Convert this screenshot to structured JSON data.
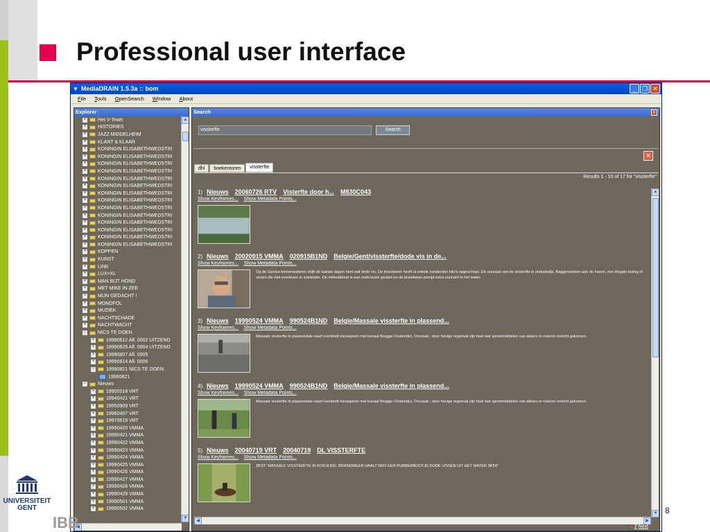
{
  "slide": {
    "title": "Professional user interface",
    "page_number": "8",
    "logo_text_1": "UNIVERSITEIT",
    "logo_text_2": "GENT",
    "partner_text": "IBB",
    "accent_color": "#e2004e"
  },
  "window": {
    "title": "MediaDRAIN 1.5.3a :: bom",
    "menu": [
      "File",
      "Tools",
      "OpenSearch",
      "Window",
      "About"
    ]
  },
  "explorer": {
    "title": "Explorer",
    "items": [
      {
        "label": "Het V-Team",
        "level": 0,
        "type": "folder"
      },
      {
        "label": "HISTORIES",
        "level": 0,
        "type": "folder"
      },
      {
        "label": "JAZZ MIDDELHEIM",
        "level": 0,
        "type": "folder"
      },
      {
        "label": "KLANT & KLAAR",
        "level": 0,
        "type": "folder"
      },
      {
        "label": "KONINGIN ELISABETHWEDSTRI",
        "level": 0,
        "type": "folder"
      },
      {
        "label": "KONINGIN ELISABETHWEDSTRI",
        "level": 0,
        "type": "folder"
      },
      {
        "label": "KONINGIN ELISABETHWEDSTRI",
        "level": 0,
        "type": "folder"
      },
      {
        "label": "KONINGIN ELISABETHWEDSTRI",
        "level": 0,
        "type": "folder"
      },
      {
        "label": "KONINGIN ELISABETHWEDSTRI",
        "level": 0,
        "type": "folder"
      },
      {
        "label": "KONINGIN ELISABETHWEDSTRI",
        "level": 0,
        "type": "folder"
      },
      {
        "label": "KONINGIN ELISABETHWEDSTRI",
        "level": 0,
        "type": "folder"
      },
      {
        "label": "KONINGIN ELISABETHWEDSTRI",
        "level": 0,
        "type": "folder"
      },
      {
        "label": "KONINGIN ELISABETHWEDSTRI",
        "level": 0,
        "type": "folder"
      },
      {
        "label": "KONINGIN ELISABETHWEDSTRI",
        "level": 0,
        "type": "folder"
      },
      {
        "label": "KONINGIN ELISABETHWEDSTRI",
        "level": 0,
        "type": "folder"
      },
      {
        "label": "KONINGIN ELISABETHWEDSTRI",
        "level": 0,
        "type": "folder"
      },
      {
        "label": "KONINGIN ELISABETHWEDSTRI",
        "level": 0,
        "type": "folder"
      },
      {
        "label": "KONINGIN ELISABETHWEDSTRI",
        "level": 0,
        "type": "folder"
      },
      {
        "label": "KOPPEN",
        "level": 0,
        "type": "folder"
      },
      {
        "label": "KUNST",
        "level": 0,
        "type": "folder"
      },
      {
        "label": "LINK",
        "level": 0,
        "type": "folder"
      },
      {
        "label": "LUX>XL",
        "level": 0,
        "type": "folder"
      },
      {
        "label": "MAN BIJT HOND",
        "level": 0,
        "type": "folder"
      },
      {
        "label": "MET MIKE IN ZEE",
        "level": 0,
        "type": "folder"
      },
      {
        "label": "MIJN GEDACHT !",
        "level": 0,
        "type": "folder"
      },
      {
        "label": "MONDFOL",
        "level": 0,
        "type": "folder"
      },
      {
        "label": "MUZIEK",
        "level": 0,
        "type": "folder"
      },
      {
        "label": "NACHTSCHADE",
        "level": 0,
        "type": "folder"
      },
      {
        "label": "NACHTWACHT",
        "level": 0,
        "type": "folder"
      },
      {
        "label": "NICS TE DOEN",
        "level": 0,
        "type": "folder-open"
      },
      {
        "label": "19990612 Afl. 0002 UITZEND",
        "level": 1,
        "type": "folder"
      },
      {
        "label": "19990626 Afl. 0004 UITZEND",
        "level": 1,
        "type": "folder"
      },
      {
        "label": "19990807 Afl. 0005",
        "level": 1,
        "type": "folder"
      },
      {
        "label": "19990814 Afl. 0006",
        "level": 1,
        "type": "folder"
      },
      {
        "label": "19990821 NICS TE DOEN:",
        "level": 1,
        "type": "folder-open"
      },
      {
        "label": "19990821",
        "level": 2,
        "type": "doc"
      },
      {
        "label": "Nieuws",
        "level": 0,
        "type": "folder-open"
      },
      {
        "label": "19900518 VRT",
        "level": 1,
        "type": "folder"
      },
      {
        "label": "19940421 VRT",
        "level": 1,
        "type": "folder"
      },
      {
        "label": "19950909 VRT",
        "level": 1,
        "type": "folder"
      },
      {
        "label": "19960407 VRT",
        "level": 1,
        "type": "folder"
      },
      {
        "label": "19970619 VRT",
        "level": 1,
        "type": "folder"
      },
      {
        "label": "19990420 VMMA",
        "level": 1,
        "type": "folder"
      },
      {
        "label": "19990421 VMMA",
        "level": 1,
        "type": "folder"
      },
      {
        "label": "19990422 VMMA",
        "level": 1,
        "type": "folder"
      },
      {
        "label": "19990423 VMMA",
        "level": 1,
        "type": "folder"
      },
      {
        "label": "19990424 VMMA",
        "level": 1,
        "type": "folder"
      },
      {
        "label": "19990425 VMMA",
        "level": 1,
        "type": "folder"
      },
      {
        "label": "19990426 VMMA",
        "level": 1,
        "type": "folder"
      },
      {
        "label": "19990427 VMMA",
        "level": 1,
        "type": "folder"
      },
      {
        "label": "19990428 VMMA",
        "level": 1,
        "type": "folder"
      },
      {
        "label": "19990429 VMMA",
        "level": 1,
        "type": "folder"
      },
      {
        "label": "19990501 VMMA",
        "level": 1,
        "type": "folder"
      },
      {
        "label": "19990502 VMMA",
        "level": 1,
        "type": "folder"
      }
    ]
  },
  "search": {
    "title": "Search",
    "query": "vissterfte",
    "button_label": "Search",
    "tabs": [
      "dhl",
      "boekentoren",
      "vissterfte"
    ],
    "active_tab": 2,
    "count_text": "Results 1 - 10 of 17 for \"vissterfte\"",
    "show_keyframes": "Show Keyframes...",
    "show_metadata": "Show Metadata Points...",
    "pager_prefix": "1",
    "pager_page": "2",
    "pager_next": "Next",
    "results": [
      {
        "num": "1)",
        "links": [
          "Nieuws",
          "20060726 RTV",
          "Visterfte door h...",
          "M830C043"
        ],
        "text": "",
        "thumb": "river-water"
      },
      {
        "num": "2)",
        "links": [
          "Nieuws",
          "20020915 VMMA",
          "020915B1ND",
          "Belgie/Gent/vissterfte/dode vis in de..."
        ],
        "text": "Op de Gentse binnenwateren drijft de laatste dagen heel wat dode vis. De brandweer heeft al enkele honderden kilo's opgeschept. De oorzaak van de vissterfte is onduidelijk. Baggerwerken aan de haven, een illegale lozing of vissen die niet overleven in zoetwater. De milieudienst is een onderzoek gestart en de brandweer pompt extra zuurstof in het water.",
        "thumb": "man-portrait"
      },
      {
        "num": "3)",
        "links": [
          "Nieuws",
          "19990524 VMMA",
          "990524B1ND",
          "Belgie/Massale vissterfte in plassend..."
        ],
        "text": "Massale vissterfte in plassendale-vaart (verbindt nieuwpoort met kanaal Brugge-Oostende). Oorzaak : door hevige regenval zijn heel wat sproeimiddelen van akkers in rivieren terecht gekomen.",
        "thumb": "water-surface"
      },
      {
        "num": "4)",
        "links": [
          "Nieuws",
          "19990524 VMMA",
          "990524B1ND",
          "Belgie/Massale vissterfte in plassend..."
        ],
        "text": "Massale vissterfte in plassendale-vaart (verbindt nieuwpoort met kanaal Brugge-Oostende). Oorzaak : door hevige regenval zijn heel wat sproeimiddelen van akkers in rivieren terecht gekomen.",
        "thumb": "people-field"
      },
      {
        "num": "5)",
        "links": [
          "Nieuws",
          "20040719 VRT",
          "20040719",
          "DL VISSTERFTE"
        ],
        "text": "38'23'' MASSALE VISSTERFTE IN KOKSIJDE. BRANDWEER HAALT DMV EEN RUBBERBOOTJE DODE VISSEN UIT HET WATER 38'54''",
        "thumb": "boat-canal"
      }
    ]
  }
}
